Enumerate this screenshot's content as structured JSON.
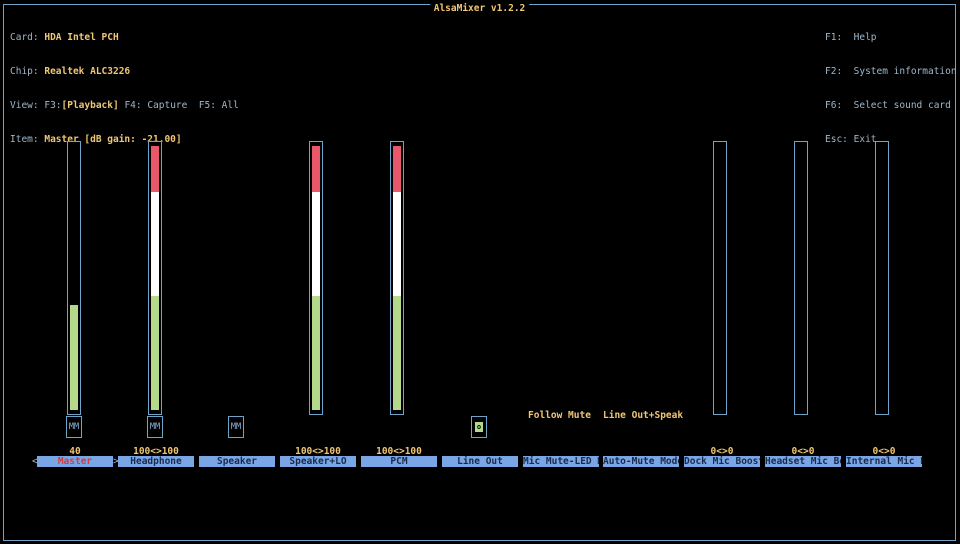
{
  "window": {
    "title": "AlsaMixer v1.2.2"
  },
  "info": {
    "card_label": "Card:",
    "card_value": "HDA Intel PCH",
    "chip_label": "Chip:",
    "chip_value": "Realtek ALC3226",
    "view_label": "View:",
    "view_f3": "F3:",
    "view_playback": "[Playback]",
    "view_rest": " F4: Capture  F5: All",
    "item_label": "Item:",
    "item_value": "Master [dB gain: -21.00]"
  },
  "help": {
    "f1_key": "F1:",
    "f1_text": "Help",
    "f2_key": "F2:",
    "f2_text": "System information",
    "f6_key": "F6:",
    "f6_text": "Select sound card",
    "esc_key": "Esc:",
    "esc_text": "Exit"
  },
  "colors": {
    "green": "#b5d98b",
    "white": "#ffffff",
    "red": "#e8576a",
    "label_bg": "#7aa6e6",
    "accent": "#f0c674"
  },
  "controls": [
    {
      "name": "Master",
      "value": "40",
      "level": 0.4,
      "mute": "MM",
      "selected": true
    },
    {
      "name": "Headphone",
      "value": "100<>100",
      "level": 1.0,
      "mute": "MM"
    },
    {
      "name": "Speaker",
      "value": "",
      "mute": "MM"
    },
    {
      "name": "Speaker+LO",
      "value": "100<>100",
      "level": 1.0
    },
    {
      "name": "PCM",
      "value": "100<>100",
      "level": 1.0
    },
    {
      "name": "Line Out",
      "value": "",
      "switch": "on"
    },
    {
      "name": "Mic Mute-LED M",
      "value": "",
      "enum": "Follow Mute"
    },
    {
      "name": "Auto-Mute Mode",
      "value": "",
      "enum": "Line Out+Speak"
    },
    {
      "name": "Dock Mic Boost",
      "value": "0<>0",
      "level": 0.0
    },
    {
      "name": "Headset Mic Bo",
      "value": "0<>0",
      "level": 0.0
    },
    {
      "name": "Internal Mic B",
      "value": "0<>0",
      "level": 0.0
    }
  ],
  "nav": {
    "left_arrow": "<",
    "right_arrow": ">"
  }
}
